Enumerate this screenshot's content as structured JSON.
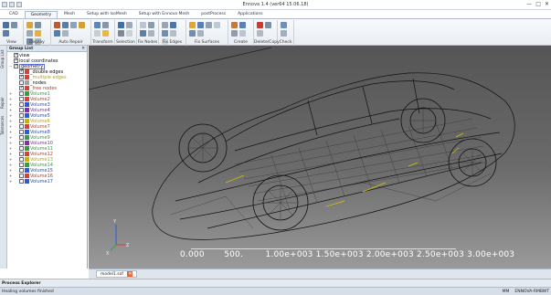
{
  "window": {
    "title": "Ennova 1.4 (ver64 15.06.18)",
    "controls": [
      "—",
      "□",
      "✕"
    ]
  },
  "tabs": [
    {
      "label": "CAD",
      "active": false
    },
    {
      "label": "Geometry",
      "active": true
    },
    {
      "label": "Mesh",
      "active": false
    },
    {
      "label": "Setup with IsoMesh",
      "active": false
    },
    {
      "label": "Setup with Ennova Mesh",
      "active": false
    },
    {
      "label": "postProcess",
      "active": false
    },
    {
      "label": "Applications",
      "active": false
    }
  ],
  "ribbon": {
    "groups": [
      "View",
      "Display",
      "Auto Repair",
      "Transform",
      "Selection",
      "Fix Nodes",
      "Fix Edges",
      "Fix Surfaces",
      "Create",
      "Delete/Copy",
      "Check"
    ]
  },
  "side_tabs": [
    "Group List",
    "Repair",
    "Tolerances"
  ],
  "tree": {
    "header": "Group List",
    "pin": "✕",
    "items": [
      {
        "label": "view",
        "color": "#111111",
        "checked": true,
        "cube": false,
        "expander": ""
      },
      {
        "label": "local coordinates",
        "color": "#111111",
        "checked": true,
        "cube": false,
        "expander": ""
      },
      {
        "label": "geometry",
        "color": "#111111",
        "checked": true,
        "cube": false,
        "expander": "−",
        "selected": true
      },
      {
        "label": "_double edges",
        "color": "#111111",
        "checked": true,
        "cube": true,
        "cube_color": "#d4423a",
        "expander": ""
      },
      {
        "label": "_multiple edges",
        "color": "#b8a400",
        "checked": true,
        "cube": true,
        "cube_color": "#d4423a",
        "expander": ""
      },
      {
        "label": "_nodes",
        "color": "#111111",
        "checked": false,
        "cube": true,
        "cube_color": "#9aa0a6",
        "expander": ""
      },
      {
        "label": "_free nodes",
        "color": "#c0392b",
        "checked": true,
        "cube": true,
        "cube_color": "#d4423a",
        "expander": ""
      },
      {
        "label": "Volume1",
        "color": "#2e9e3e",
        "checked": false,
        "cube": true,
        "cube_color": "#3b9a45",
        "expander": "+"
      },
      {
        "label": "Volume2",
        "color": "#c0392b",
        "checked": false,
        "cube": true,
        "cube_color": "#d4423a",
        "expander": "+"
      },
      {
        "label": "Volume3",
        "color": "#1f4fd1",
        "checked": false,
        "cube": true,
        "cube_color": "#2d5ad8",
        "expander": "+"
      },
      {
        "label": "Volume4",
        "color": "#8a2da8",
        "checked": false,
        "cube": true,
        "cube_color": "#8a2da8",
        "expander": "+"
      },
      {
        "label": "Volume5",
        "color": "#1f4fd1",
        "checked": false,
        "cube": true,
        "cube_color": "#2d5ad8",
        "expander": "+"
      },
      {
        "label": "Volume6",
        "color": "#b8a400",
        "checked": false,
        "cube": true,
        "cube_color": "#c8b400",
        "expander": "+"
      },
      {
        "label": "Volume7",
        "color": "#c0392b",
        "checked": false,
        "cube": true,
        "cube_color": "#d4423a",
        "expander": "+"
      },
      {
        "label": "Volume8",
        "color": "#1f4fd1",
        "checked": false,
        "cube": true,
        "cube_color": "#2d5ad8",
        "expander": "+"
      },
      {
        "label": "Volume9",
        "color": "#2e9e3e",
        "checked": false,
        "cube": true,
        "cube_color": "#3b9a45",
        "expander": "+"
      },
      {
        "label": "Volume10",
        "color": "#8a2da8",
        "checked": false,
        "cube": true,
        "cube_color": "#8a2da8",
        "expander": "+"
      },
      {
        "label": "Volume11",
        "color": "#2e9e3e",
        "checked": false,
        "cube": true,
        "cube_color": "#3b9a45",
        "expander": "+"
      },
      {
        "label": "Volume12",
        "color": "#c0392b",
        "checked": false,
        "cube": true,
        "cube_color": "#d4423a",
        "expander": "+"
      },
      {
        "label": "Volume13",
        "color": "#b8a400",
        "checked": false,
        "cube": true,
        "cube_color": "#c8b400",
        "expander": "+"
      },
      {
        "label": "Volume14",
        "color": "#2e9e3e",
        "checked": false,
        "cube": true,
        "cube_color": "#3b9a45",
        "expander": "+"
      },
      {
        "label": "Volume15",
        "color": "#1f4fd1",
        "checked": false,
        "cube": true,
        "cube_color": "#2d5ad8",
        "expander": "+"
      },
      {
        "label": "Volume16",
        "color": "#c0392b",
        "checked": false,
        "cube": true,
        "cube_color": "#d4423a",
        "expander": "+"
      },
      {
        "label": "Volume17",
        "color": "#1f4fd1",
        "checked": false,
        "cube": true,
        "cube_color": "#2d5ad8",
        "expander": "+"
      }
    ]
  },
  "viewport": {
    "scale_text": "0.000       500.        1.00e+003 1.50e+003 2.00e+003 2.50e+003 3.00e+003",
    "axes_labels": {
      "y": "Y",
      "z": "Z",
      "x": "X"
    }
  },
  "doc_tab": {
    "label": "model1.sof",
    "close": "✕"
  },
  "process_explorer": {
    "label": "Process Explorer"
  },
  "status": {
    "message": "Healing volumes finished",
    "right": [
      "MM",
      "ENNOVA-RMBWT"
    ]
  },
  "colors": {
    "ribbon_bg": "#eef2f7",
    "accent": "#aebccc"
  }
}
